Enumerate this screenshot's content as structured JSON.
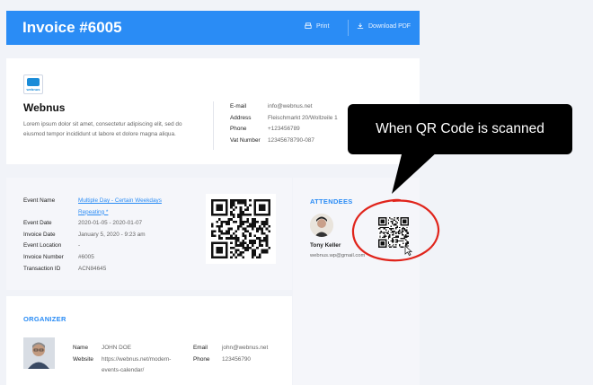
{
  "header": {
    "title": "Invoice #6005",
    "print": "Print",
    "download": "Download PDF"
  },
  "company": {
    "logo_text": "webnus",
    "name": "Webnus",
    "description": "Lorem ipsum dolor sit amet, consectetur adipiscing elit, sed do eiusmod tempor incididunt ut labore et dolore magna aliqua.",
    "fields": [
      {
        "k": "E-mail",
        "v": "info@webnus.net"
      },
      {
        "k": "Address",
        "v": "Fleischmarkt 20/Wollzeile 1"
      },
      {
        "k": "Phone",
        "v": "+123456789"
      },
      {
        "k": "Vat Number",
        "v": "12345678790-087"
      }
    ]
  },
  "event": {
    "name_label": "Event Name",
    "name_value": "Multiple Day - Certain Weekdays Repeating *",
    "fields": [
      {
        "k": "Event Date",
        "v": "2020-01-05 - 2020-01-07"
      },
      {
        "k": "Invoice Date",
        "v": "January 5, 2020 - 9:23 am"
      },
      {
        "k": "Event Location",
        "v": "-"
      },
      {
        "k": "Invoice Number",
        "v": "#6005"
      },
      {
        "k": "Transaction ID",
        "v": "ACN84645"
      }
    ]
  },
  "attendees": {
    "title": "ATTENDEES",
    "name": "Tony Keller",
    "email": "webnus.wp@gmail.com"
  },
  "organizer": {
    "title": "ORGANIZER",
    "name_label": "Name",
    "name": "JOHN DOE",
    "website_label": "Website",
    "website": "https://webnus.net/modern-events-calendar/",
    "email_label": "Email",
    "email": "john@webnus.net",
    "phone_label": "Phone",
    "phone": "123456790"
  },
  "callout": {
    "text": "When QR Code is scanned"
  },
  "colors": {
    "accent": "#2a8cf5",
    "highlight_circle": "#e0241b"
  }
}
